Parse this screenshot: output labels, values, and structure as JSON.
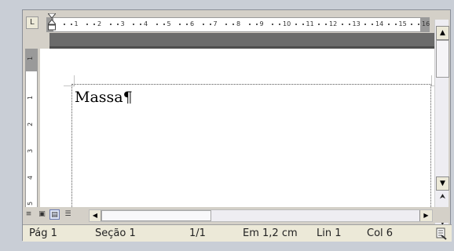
{
  "ruler": {
    "corner_symbol": "L",
    "h_numbers": [
      "1",
      "2",
      "3",
      "4",
      "5",
      "6",
      "7",
      "8",
      "9",
      "10",
      "11",
      "12",
      "13",
      "14",
      "15",
      "16"
    ],
    "v_numbers": [
      "1",
      "1",
      "2",
      "3",
      "4",
      "5"
    ]
  },
  "document": {
    "text": "Massa¶"
  },
  "scrollbar": {
    "up_icon": "scroll-up-arrow",
    "down_icon": "scroll-down-arrow",
    "prev_page_icon": "double-up-arrow",
    "select_browse_icon": "browse-object-circle",
    "next_page_icon": "double-down-arrow"
  },
  "view_buttons": [
    "normal-view",
    "web-layout-view",
    "print-layout-view",
    "outline-view"
  ],
  "statusbar": {
    "page": "Pág 1",
    "section": "Seção 1",
    "pages": "1/1",
    "position": "Em 1,2 cm",
    "line": "Lin 1",
    "column": "Col 6"
  },
  "colors": {
    "chrome": "#d4d0c8",
    "status_bg": "#ece9d8",
    "ruler_margin": "#9a9a9a"
  }
}
